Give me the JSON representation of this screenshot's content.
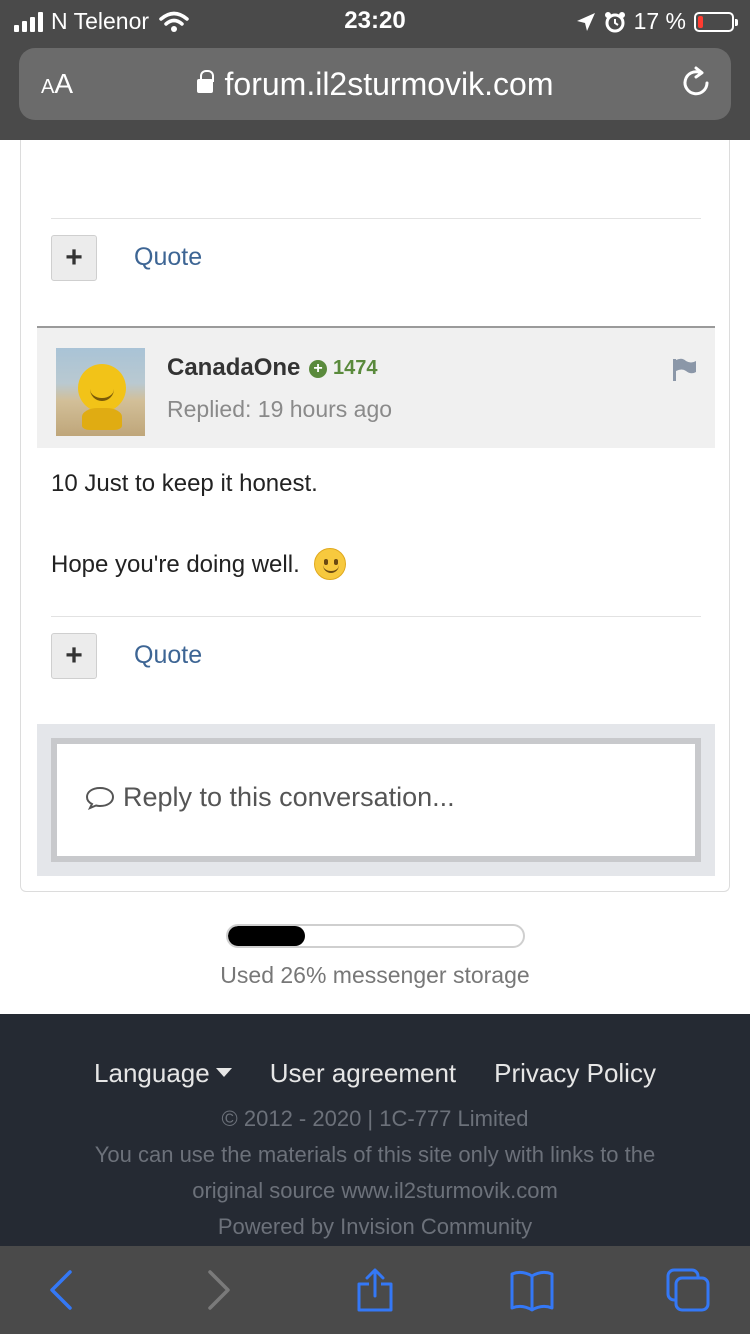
{
  "status_bar": {
    "carrier": "N Telenor",
    "time": "23:20",
    "battery_percent": "17 %",
    "battery_level": 0.17,
    "battery_color": "#ff3b30"
  },
  "address_bar": {
    "text_size_button": "AA",
    "url": "forum.il2sturmovik.com",
    "icons": [
      "lock-icon",
      "reload-icon"
    ]
  },
  "first_post": {
    "plus_button": "+",
    "quote_label": "Quote"
  },
  "second_post": {
    "author": "CanadaOne",
    "reputation": "1474",
    "replied": "Replied: 19 hours ago",
    "body_line_1": "10 Just to keep it honest.",
    "body_line_2": "Hope you're doing well.",
    "plus_button": "+",
    "quote_label": "Quote"
  },
  "reply_box": {
    "placeholder": "Reply to this conversation..."
  },
  "storage": {
    "used_fraction": 0.26,
    "label": "Used 26% messenger storage"
  },
  "footer": {
    "language": "Language",
    "user_agreement": "User agreement",
    "privacy_policy": "Privacy Policy",
    "copyright": "© 2012 - 2020 | 1C-777 Limited",
    "materials_line_1": "You can use the materials of this site only with links to the",
    "materials_line_2": "original source www.il2sturmovik.com",
    "powered": "Powered by Invision Community"
  },
  "toolbar": {
    "icons": [
      "back-icon",
      "forward-icon",
      "share-icon",
      "bookmarks-icon",
      "tabs-icon"
    ]
  },
  "colors": {
    "link": "#3d6594",
    "reputation": "#5a8a3c",
    "ios_blue": "#3478f6"
  }
}
